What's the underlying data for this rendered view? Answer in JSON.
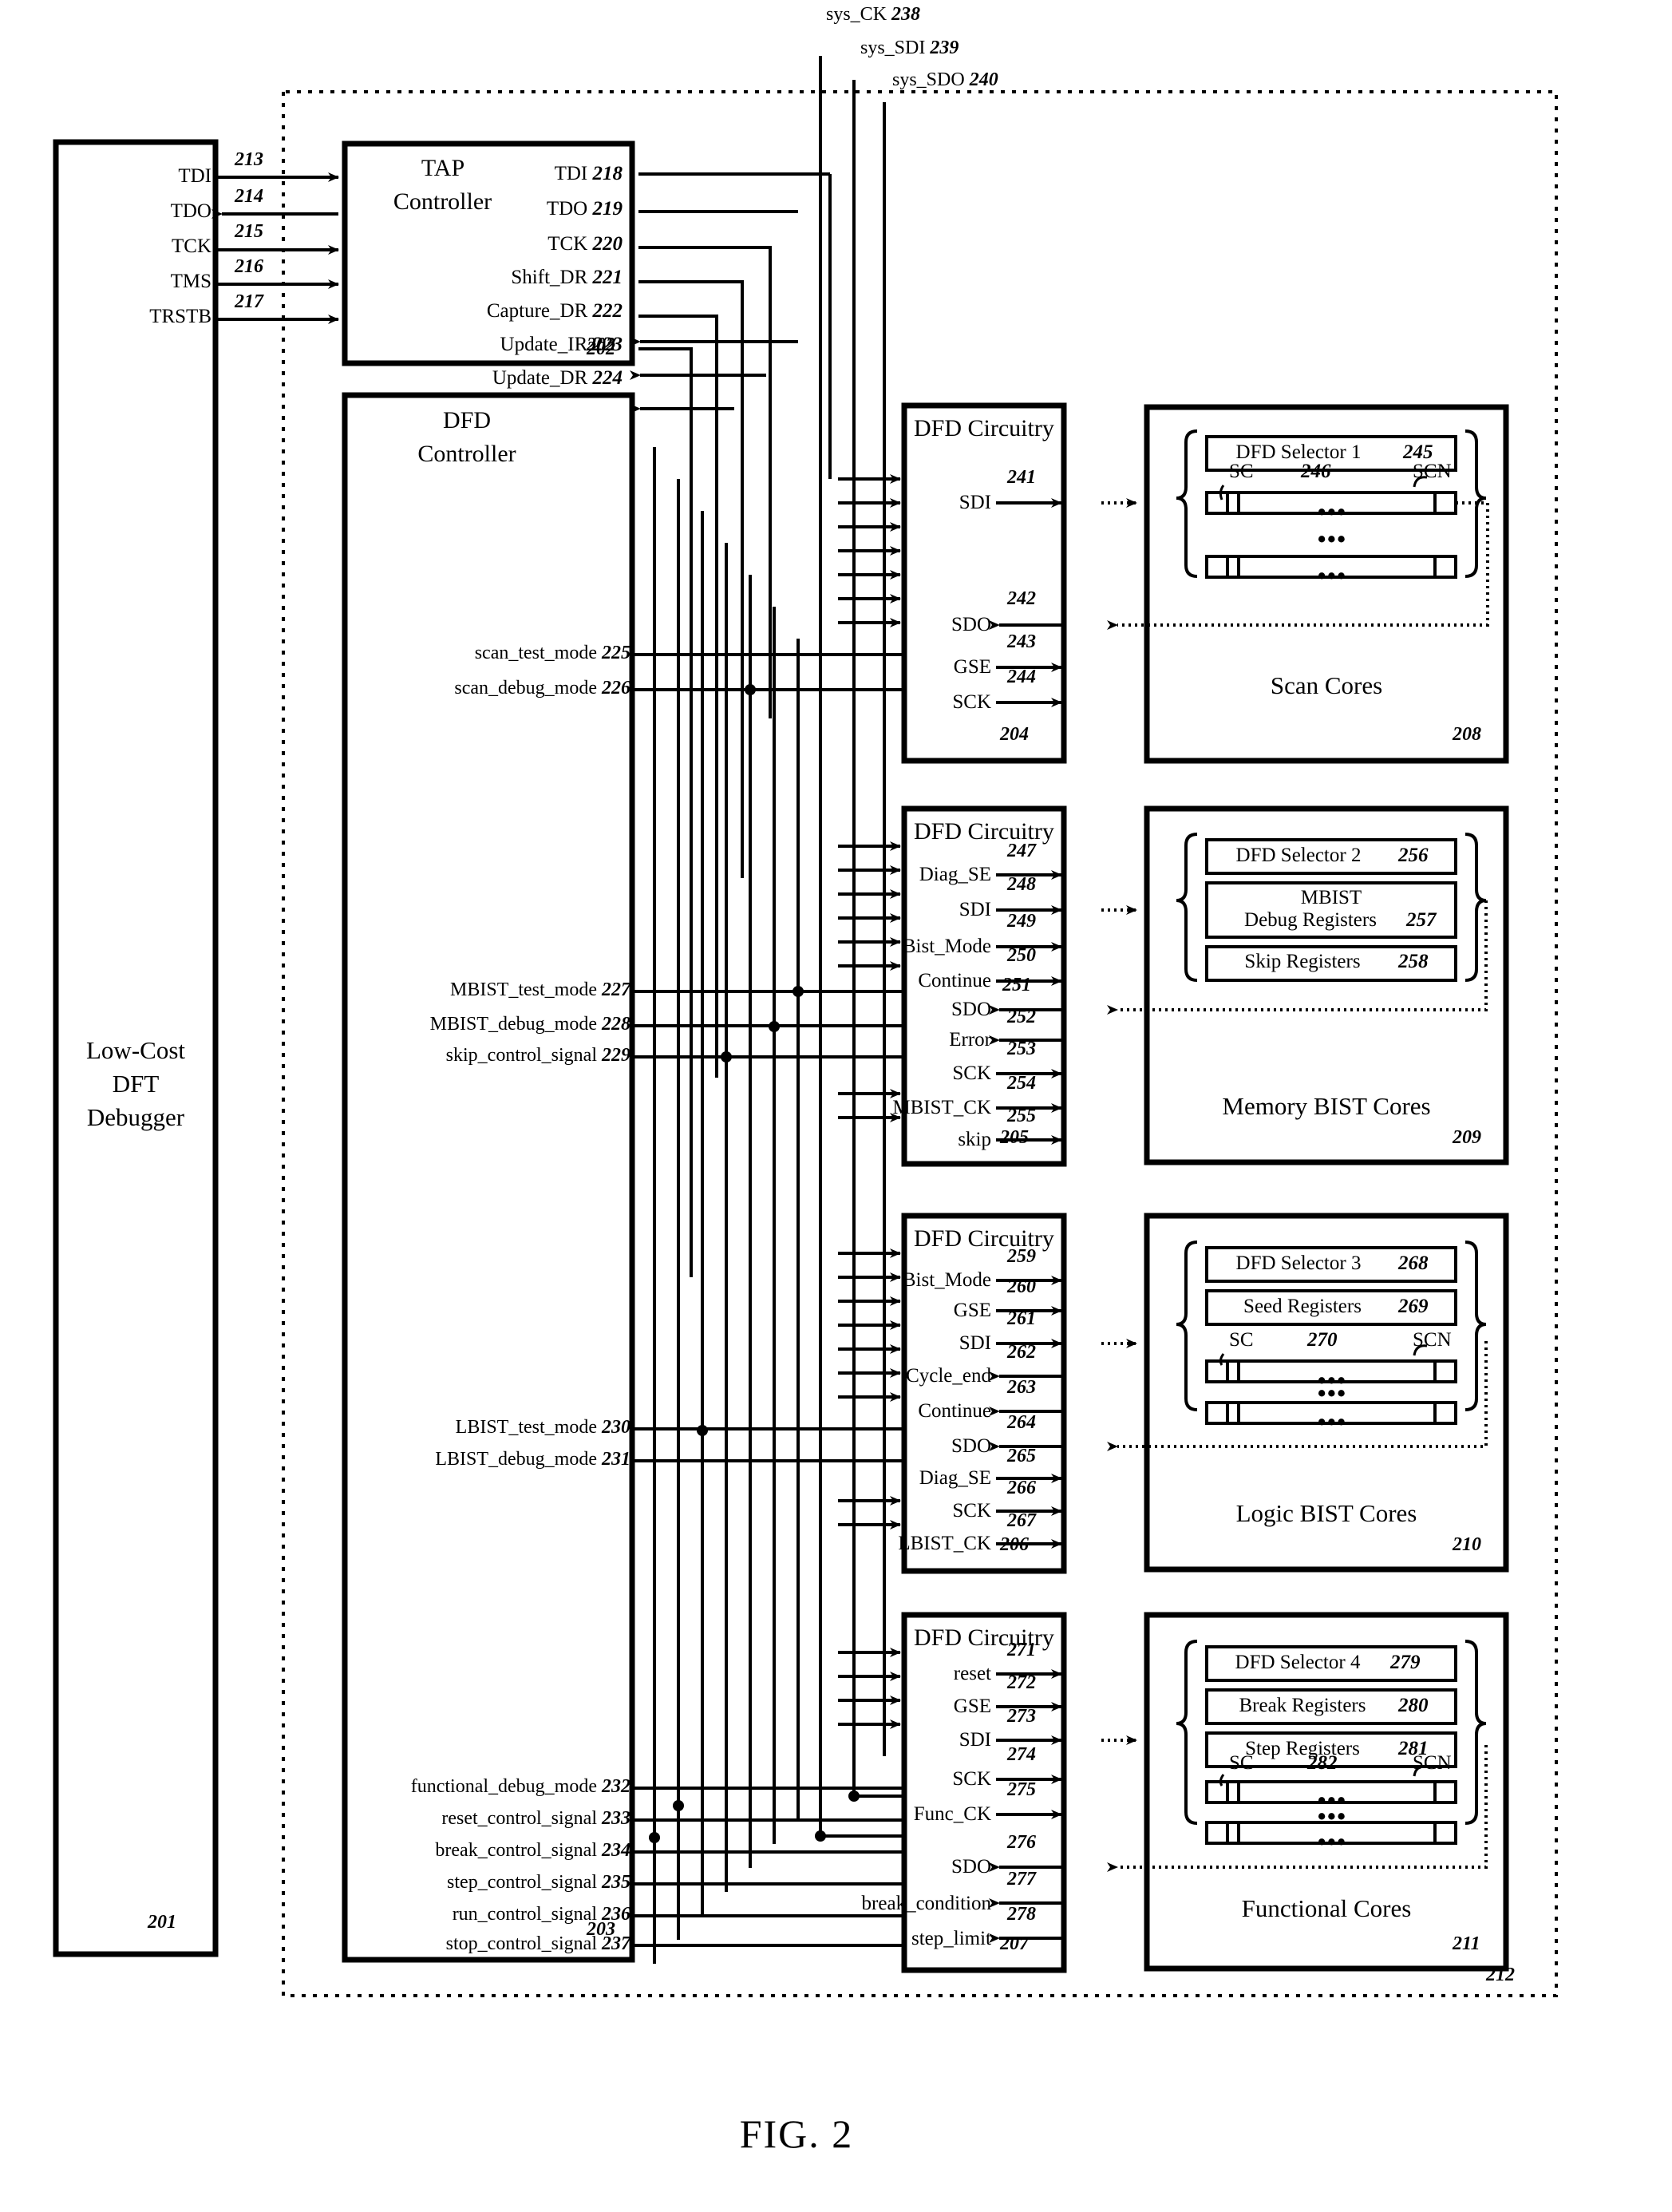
{
  "figure": {
    "caption": "FIG. 2"
  },
  "top_signals": [
    {
      "label": "sys_CK",
      "num": "238"
    },
    {
      "label": "sys_SDI",
      "num": "239"
    },
    {
      "label": "sys_SDO",
      "num": "240"
    }
  ],
  "debugger": {
    "title_lines": [
      "Low-Cost",
      "DFT",
      "Debugger"
    ],
    "num": "201",
    "ports": [
      {
        "label": "TDI",
        "num": "213"
      },
      {
        "label": "TDO",
        "num": "214"
      },
      {
        "label": "TCK",
        "num": "215"
      },
      {
        "label": "TMS",
        "num": "216"
      },
      {
        "label": "TRSTB",
        "num": "217"
      }
    ]
  },
  "tap_controller": {
    "title_lines": [
      "TAP",
      "Controller"
    ],
    "num": "202",
    "ports": [
      {
        "label": "TDI",
        "num": "218"
      },
      {
        "label": "TDO",
        "num": "219"
      },
      {
        "label": "TCK",
        "num": "220"
      },
      {
        "label": "Shift_DR",
        "num": "221"
      },
      {
        "label": "Capture_DR",
        "num": "222"
      },
      {
        "label": "Update_IR",
        "num": "223"
      },
      {
        "label": "Update_DR",
        "num": "224"
      }
    ]
  },
  "dfd_controller": {
    "title_lines": [
      "DFD",
      "Controller"
    ],
    "num": "203",
    "ports": [
      {
        "label": "scan_test_mode",
        "num": "225"
      },
      {
        "label": "scan_debug_mode",
        "num": "226"
      },
      {
        "label": "MBIST_test_mode",
        "num": "227"
      },
      {
        "label": "MBIST_debug_mode",
        "num": "228"
      },
      {
        "label": "skip_control_signal",
        "num": "229"
      },
      {
        "label": "LBIST_test_mode",
        "num": "230"
      },
      {
        "label": "LBIST_debug_mode",
        "num": "231"
      },
      {
        "label": "functional_debug_mode",
        "num": "232"
      },
      {
        "label": "reset_control_signal",
        "num": "233"
      },
      {
        "label": "break_control_signal",
        "num": "234"
      },
      {
        "label": "step_control_signal",
        "num": "235"
      },
      {
        "label": "run_control_signal",
        "num": "236"
      },
      {
        "label": "stop_control_signal",
        "num": "237"
      }
    ]
  },
  "groups": [
    {
      "circuitry": {
        "title": "DFD Circuitry",
        "num": "204",
        "ports": [
          {
            "label": "SDI",
            "num": "241",
            "dir": "out"
          },
          {
            "label": "SDO",
            "num": "242",
            "dir": "in"
          },
          {
            "label": "GSE",
            "num": "243",
            "dir": "out"
          },
          {
            "label": "SCK",
            "num": "244",
            "dir": "out"
          }
        ]
      },
      "cores": {
        "title": "Scan Cores",
        "num": "208",
        "selector": {
          "label": "DFD Selector 1",
          "num": "245"
        },
        "registers": [],
        "chain": {
          "sc": "SC",
          "num": "246",
          "scn": "SCN"
        }
      }
    },
    {
      "circuitry": {
        "title": "DFD Circuitry",
        "num": "205",
        "ports": [
          {
            "label": "Diag_SE",
            "num": "247",
            "dir": "out"
          },
          {
            "label": "SDI",
            "num": "248",
            "dir": "out"
          },
          {
            "label": "Bist_Mode",
            "num": "249",
            "dir": "out"
          },
          {
            "label": "Continue",
            "num": "250",
            "dir": "out"
          },
          {
            "label": "SDO",
            "num": "251",
            "dir": "in"
          },
          {
            "label": "Error",
            "num": "252",
            "dir": "in"
          },
          {
            "label": "SCK",
            "num": "253",
            "dir": "out"
          },
          {
            "label": "MBIST_CK",
            "num": "254",
            "dir": "out"
          },
          {
            "label": "skip",
            "num": "255",
            "dir": "out"
          }
        ]
      },
      "cores": {
        "title": "Memory BIST Cores",
        "num": "209",
        "selector": {
          "label": "DFD Selector 2",
          "num": "256"
        },
        "registers": [
          {
            "label": "MBIST\nDebug Registers",
            "num": "257"
          },
          {
            "label": "Skip Registers",
            "num": "258"
          }
        ],
        "chain": null
      }
    },
    {
      "circuitry": {
        "title": "DFD Circuitry",
        "num": "206",
        "ports": [
          {
            "label": "Bist_Mode",
            "num": "259",
            "dir": "out"
          },
          {
            "label": "GSE",
            "num": "260",
            "dir": "out"
          },
          {
            "label": "SDI",
            "num": "261",
            "dir": "out"
          },
          {
            "label": "Cycle_end",
            "num": "262",
            "dir": "in"
          },
          {
            "label": "Continue",
            "num": "263",
            "dir": "in"
          },
          {
            "label": "SDO",
            "num": "264",
            "dir": "in"
          },
          {
            "label": "Diag_SE",
            "num": "265",
            "dir": "out"
          },
          {
            "label": "SCK",
            "num": "266",
            "dir": "out"
          },
          {
            "label": "LBIST_CK",
            "num": "267",
            "dir": "out"
          }
        ]
      },
      "cores": {
        "title": "Logic BIST Cores",
        "num": "210",
        "selector": {
          "label": "DFD Selector 3",
          "num": "268"
        },
        "registers": [
          {
            "label": "Seed Registers",
            "num": "269"
          }
        ],
        "chain": {
          "sc": "SC",
          "num": "270",
          "scn": "SCN"
        }
      }
    },
    {
      "circuitry": {
        "title": "DFD Circuitry",
        "num": "207",
        "ports": [
          {
            "label": "reset",
            "num": "271",
            "dir": "out"
          },
          {
            "label": "GSE",
            "num": "272",
            "dir": "out"
          },
          {
            "label": "SDI",
            "num": "273",
            "dir": "out"
          },
          {
            "label": "SCK",
            "num": "274",
            "dir": "out"
          },
          {
            "label": "Func_CK",
            "num": "275",
            "dir": "out"
          },
          {
            "label": "SDO",
            "num": "276",
            "dir": "in"
          },
          {
            "label": "break_condition",
            "num": "277",
            "dir": "in"
          },
          {
            "label": "step_limit",
            "num": "278",
            "dir": "in"
          }
        ]
      },
      "cores": {
        "title": "Functional Cores",
        "num": "211",
        "selector": {
          "label": "DFD Selector 4",
          "num": "279"
        },
        "registers": [
          {
            "label": "Break Registers",
            "num": "280"
          },
          {
            "label": "Step Registers",
            "num": "281"
          }
        ],
        "chain": {
          "sc": "SC",
          "num": "282",
          "scn": "SCN"
        }
      }
    }
  ],
  "chip_boundary": {
    "num": "212"
  }
}
